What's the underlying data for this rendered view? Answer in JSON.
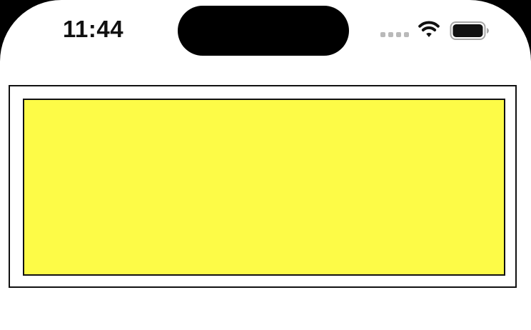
{
  "status_bar": {
    "time": "11:44",
    "signal_icon": "cellular-signal-icon",
    "wifi_icon": "wifi-icon",
    "battery_icon": "battery-icon",
    "signal_active_bars": 0,
    "battery_level": 1.0
  },
  "colors": {
    "device_frame": "#000000",
    "screen_background": "#ffffff",
    "panel_fill": "#fdfb47",
    "border": "#111111",
    "inactive_signal": "#b9b9b9"
  }
}
